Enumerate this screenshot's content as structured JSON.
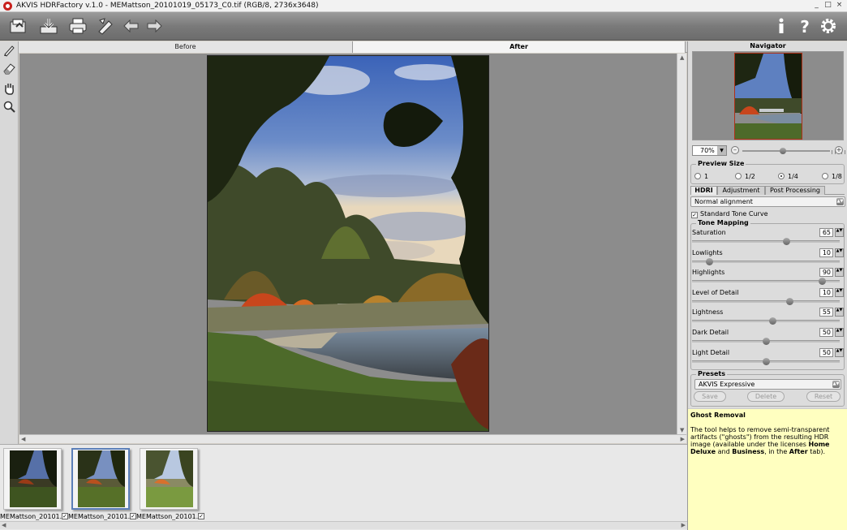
{
  "window": {
    "title": "AKVIS HDRFactory v.1.0 - MEMattson_20101019_05173_C0.tif (RGB/8, 2736x3648)",
    "controls": [
      "_",
      "□",
      "×"
    ]
  },
  "toolbar": {
    "icons": [
      "open-icon",
      "save-icon",
      "print-icon",
      "brush-icon",
      "undo-icon",
      "redo-icon",
      "info-icon",
      "help-icon",
      "settings-icon"
    ]
  },
  "left_tools": [
    "brush-tool-icon",
    "eraser-tool-icon",
    "hand-tool-icon",
    "zoom-tool-icon"
  ],
  "tabs": {
    "before": "Before",
    "after": "After"
  },
  "filmstrip": {
    "items": [
      {
        "caption": "MEMattson_20101...",
        "checked": true,
        "selected": false
      },
      {
        "caption": "MEMattson_20101...",
        "checked": true,
        "selected": true
      },
      {
        "caption": "MEMattson_20101...",
        "checked": true,
        "selected": false
      }
    ]
  },
  "navigator": {
    "title": "Navigator",
    "zoom": "70%",
    "zoom_level": 0.46
  },
  "preview_size": {
    "title": "Preview Size",
    "options": [
      "1",
      "1/2",
      "1/4",
      "1/8"
    ],
    "selected": "1/4"
  },
  "panel_tabs": {
    "hdri": "HDRI",
    "adjustment": "Adjustment",
    "post": "Post Processing"
  },
  "alignment": "Normal alignment",
  "standard_tone_curve": {
    "label": "Standard Tone Curve",
    "checked": true
  },
  "tone_mapping": {
    "title": "Tone Mapping",
    "params": [
      {
        "label": "Saturation",
        "value": "65",
        "level": 0.65
      },
      {
        "label": "Lowlights",
        "value": "10",
        "level": 0.1
      },
      {
        "label": "Highlights",
        "value": "90",
        "level": 0.9
      },
      {
        "label": "Level of Detail",
        "value": "10",
        "level": 0.67
      },
      {
        "label": "Lightness",
        "value": "55",
        "level": 0.55
      },
      {
        "label": "Dark Detail",
        "value": "50",
        "level": 0.5
      },
      {
        "label": "Light Detail",
        "value": "50",
        "level": 0.5
      }
    ]
  },
  "presets": {
    "title": "Presets",
    "selected": "AKVIS Expressive",
    "save": "Save",
    "delete": "Delete",
    "reset": "Reset"
  },
  "help": {
    "title": "Ghost Removal",
    "text_1": "The tool helps to remove semi-transparent artifacts (\"ghosts\") from the resulting HDR image (available under the licenses ",
    "bold_1": "Home Deluxe",
    "text_2": " and ",
    "bold_2": "Business",
    "text_3": ", in the ",
    "bold_3": "After",
    "text_4": " tab)."
  }
}
